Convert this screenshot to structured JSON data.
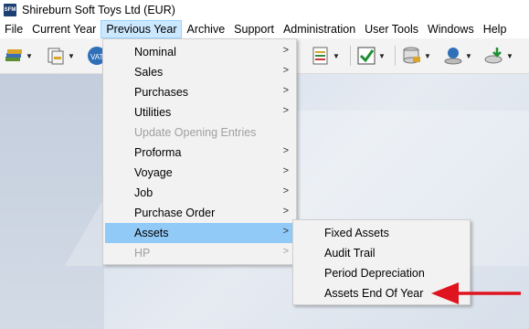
{
  "window": {
    "title": "Shireburn Soft Toys Ltd (EUR)",
    "app_icon_text": "SFM"
  },
  "menubar": [
    "File",
    "Current Year",
    "Previous Year",
    "Archive",
    "Support",
    "Administration",
    "User Tools",
    "Windows",
    "Help"
  ],
  "active_menu": "Previous Year",
  "dropdown": [
    {
      "label": "Nominal",
      "submenu": true
    },
    {
      "label": "Sales",
      "submenu": true
    },
    {
      "label": "Purchases",
      "submenu": true
    },
    {
      "label": "Utilities",
      "submenu": true
    },
    {
      "label": "Update Opening Entries",
      "submenu": false,
      "disabled": true
    },
    {
      "label": "Proforma",
      "submenu": true
    },
    {
      "label": "Voyage",
      "submenu": true
    },
    {
      "label": "Job",
      "submenu": true
    },
    {
      "label": "Purchase Order",
      "submenu": true
    },
    {
      "label": "Assets",
      "submenu": true,
      "highlighted": true
    },
    {
      "label": "HP",
      "submenu": true,
      "disabled": true
    }
  ],
  "submenu": [
    "Fixed Assets",
    "Audit Trail",
    "Period Depreciation",
    "Assets End Of Year"
  ],
  "colors": {
    "highlight": "#91c9f7",
    "arrow": "#e0141e",
    "active_menu_bg": "#cce8ff"
  },
  "toolbar_icons": [
    "ledger-stack-icon",
    "documents-icon",
    "vat-icon",
    "notes-icon",
    "checklist-icon",
    "database-icon",
    "user-disk-icon",
    "download-disk-icon"
  ]
}
